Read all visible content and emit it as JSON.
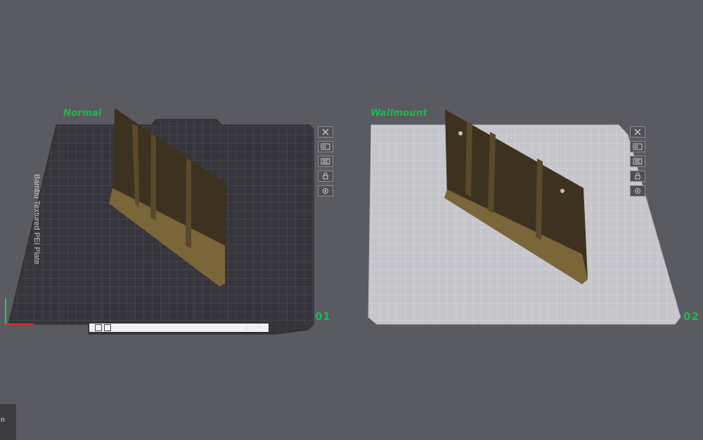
{
  "plates": [
    {
      "name": "Normal",
      "index": "01",
      "bed_label": "Bambu Textured PEI Plate"
    },
    {
      "name": "Wallmount",
      "index": "02"
    }
  ],
  "plate_icons": [
    "close-icon",
    "arrange-icon",
    "orient-icon",
    "lock-icon",
    "settings-icon"
  ],
  "bed_bar": {
    "text": "",
    "text2": ""
  },
  "bottom_tab": {
    "label": "n"
  },
  "colors": {
    "background": "#5a5a61",
    "plate_dark": "#35353b",
    "plate_light": "#c5c5cb",
    "model": "#6e5a35",
    "accent_green": "#1fb84c"
  }
}
